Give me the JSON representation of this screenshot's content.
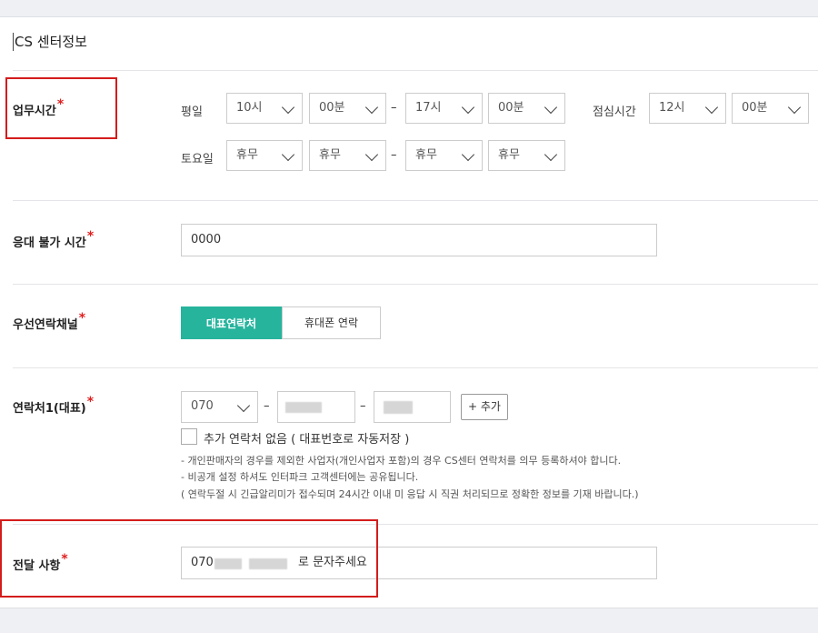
{
  "section_title": "CS 센터정보",
  "business_hours": {
    "label": "업무시간",
    "required_mark": "*",
    "weekday": {
      "label": "평일",
      "start_hour": "10시",
      "start_min": "00분",
      "end_hour": "17시",
      "end_min": "00분"
    },
    "lunch": {
      "label": "점심시간",
      "hour": "12시",
      "min": "00분"
    },
    "saturday": {
      "label": "토요일",
      "start_hour": "휴무",
      "start_min": "휴무",
      "end_hour": "휴무",
      "end_min": "휴무"
    },
    "dash": "–"
  },
  "unavailable_time": {
    "label": "응대 불가 시간",
    "required_mark": "*",
    "value": "0000"
  },
  "priority_channel": {
    "label": "우선연락채널",
    "required_mark": "*",
    "option_primary": "대표연락처",
    "option_mobile": "휴대폰 연락"
  },
  "contact1": {
    "label": "연락처1(대표)",
    "required_mark": "*",
    "prefix": "070",
    "dash": "–",
    "add_button": "+ 추가",
    "no_extra_checkbox": "추가 연락처 없음 ( 대표번호로 자동저장 )",
    "notes": [
      "- 개인판매자의 경우를 제외한 사업자(개인사업자 포함)의 경우 CS센터 연락처를 의무 등록하셔야 합니다.",
      "- 비공개 설정 하셔도 인터파크 고객센터에는 공유됩니다.",
      "( 연락두절 시 긴급알리미가 접수되며 24시간 이내 미 응답 시 직권 처리되므로 정확한 정보를 기재 바랍니다.)"
    ]
  },
  "delivery_note": {
    "label": "전달 사항",
    "required_mark": "*",
    "value_prefix": "070",
    "value_suffix": "로 문자주세요"
  },
  "colors": {
    "accent": "#26b49d",
    "required": "#e02020",
    "highlight_box": "#d41c1c"
  }
}
